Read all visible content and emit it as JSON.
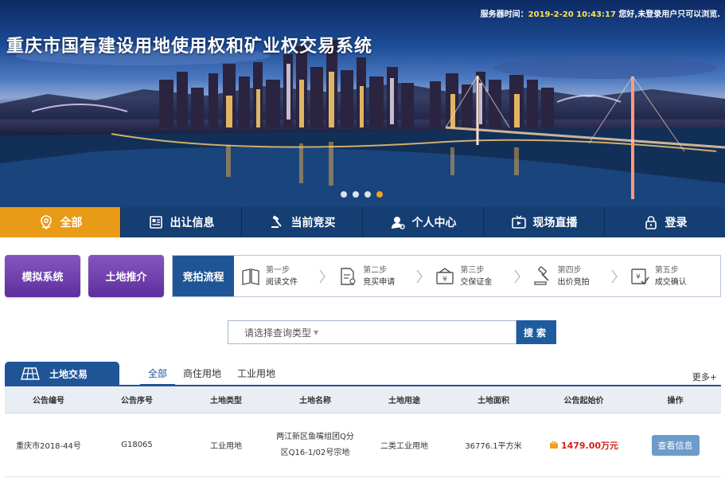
{
  "header": {
    "server_label": "服务器时间：",
    "server_time": "2019-2-20 10:43:17",
    "login_notice": "您好,未登录用户只可以浏览.",
    "site_title": "重庆市国有建设用地使用权和矿业权交易系统"
  },
  "carousel": {
    "slide_count": 4,
    "active_index": 3
  },
  "nav": {
    "items": [
      {
        "label": "全部",
        "icon": "location-pin-icon",
        "active": true
      },
      {
        "label": "出让信息",
        "icon": "news-icon",
        "active": false
      },
      {
        "label": "当前竞买",
        "icon": "auction-hammer-icon",
        "active": false
      },
      {
        "label": "个人中心",
        "icon": "user-icon",
        "active": false
      },
      {
        "label": "现场直播",
        "icon": "tv-icon",
        "active": false
      },
      {
        "label": "登录",
        "icon": "lock-icon",
        "active": false
      }
    ]
  },
  "quick": {
    "simulate": "模拟系统",
    "recommend": "土地推介"
  },
  "flow": {
    "label": "竞拍流程",
    "steps": [
      {
        "step": "第一步",
        "name": "阅读文件",
        "icon": "book-icon"
      },
      {
        "step": "第二步",
        "name": "竞买申请",
        "icon": "application-form-icon"
      },
      {
        "step": "第三步",
        "name": "交保证金",
        "icon": "deposit-icon"
      },
      {
        "step": "第四步",
        "name": "出价竞拍",
        "icon": "bid-hammer-icon"
      },
      {
        "step": "第五步",
        "name": "成交确认",
        "icon": "confirm-icon"
      }
    ]
  },
  "search": {
    "placeholder": "请选择查询类型",
    "button": "搜索"
  },
  "section": {
    "title": "土地交易",
    "tabs": [
      "全部",
      "商住用地",
      "工业用地"
    ],
    "active_tab": 0,
    "more": "更多+"
  },
  "table": {
    "columns": [
      "公告编号",
      "公告序号",
      "土地类型",
      "土地名称",
      "土地用途",
      "土地面积",
      "公告起始价",
      "操作"
    ],
    "rows": [
      {
        "notice_no": "重庆市2018-44号",
        "serial": "G18065",
        "type": "工业用地",
        "name": "两江新区鱼嘴组团Q分区Q16-1/02号宗地",
        "usage": "二类工业用地",
        "area": "36776.1平方米",
        "price": "1479.00万元",
        "action": "查看信息"
      }
    ]
  }
}
